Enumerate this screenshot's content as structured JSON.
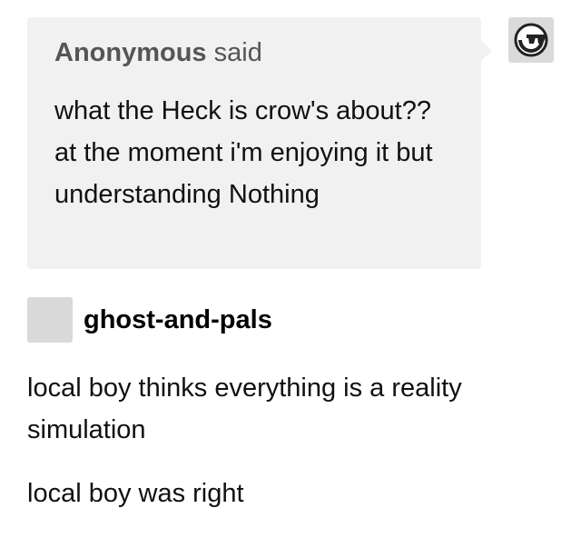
{
  "ask": {
    "asker_name": "Anonymous",
    "asker_verb": "said",
    "question": "what the Heck is crow's about?? at the moment i'm enjoying it but understanding Nothing",
    "avatar_icon": "anonymous-sunglasses-icon"
  },
  "answer": {
    "blog_name": "ghost-and-pals",
    "paragraphs": [
      "local boy thinks everything is a reality simulation",
      "local boy was right"
    ]
  }
}
